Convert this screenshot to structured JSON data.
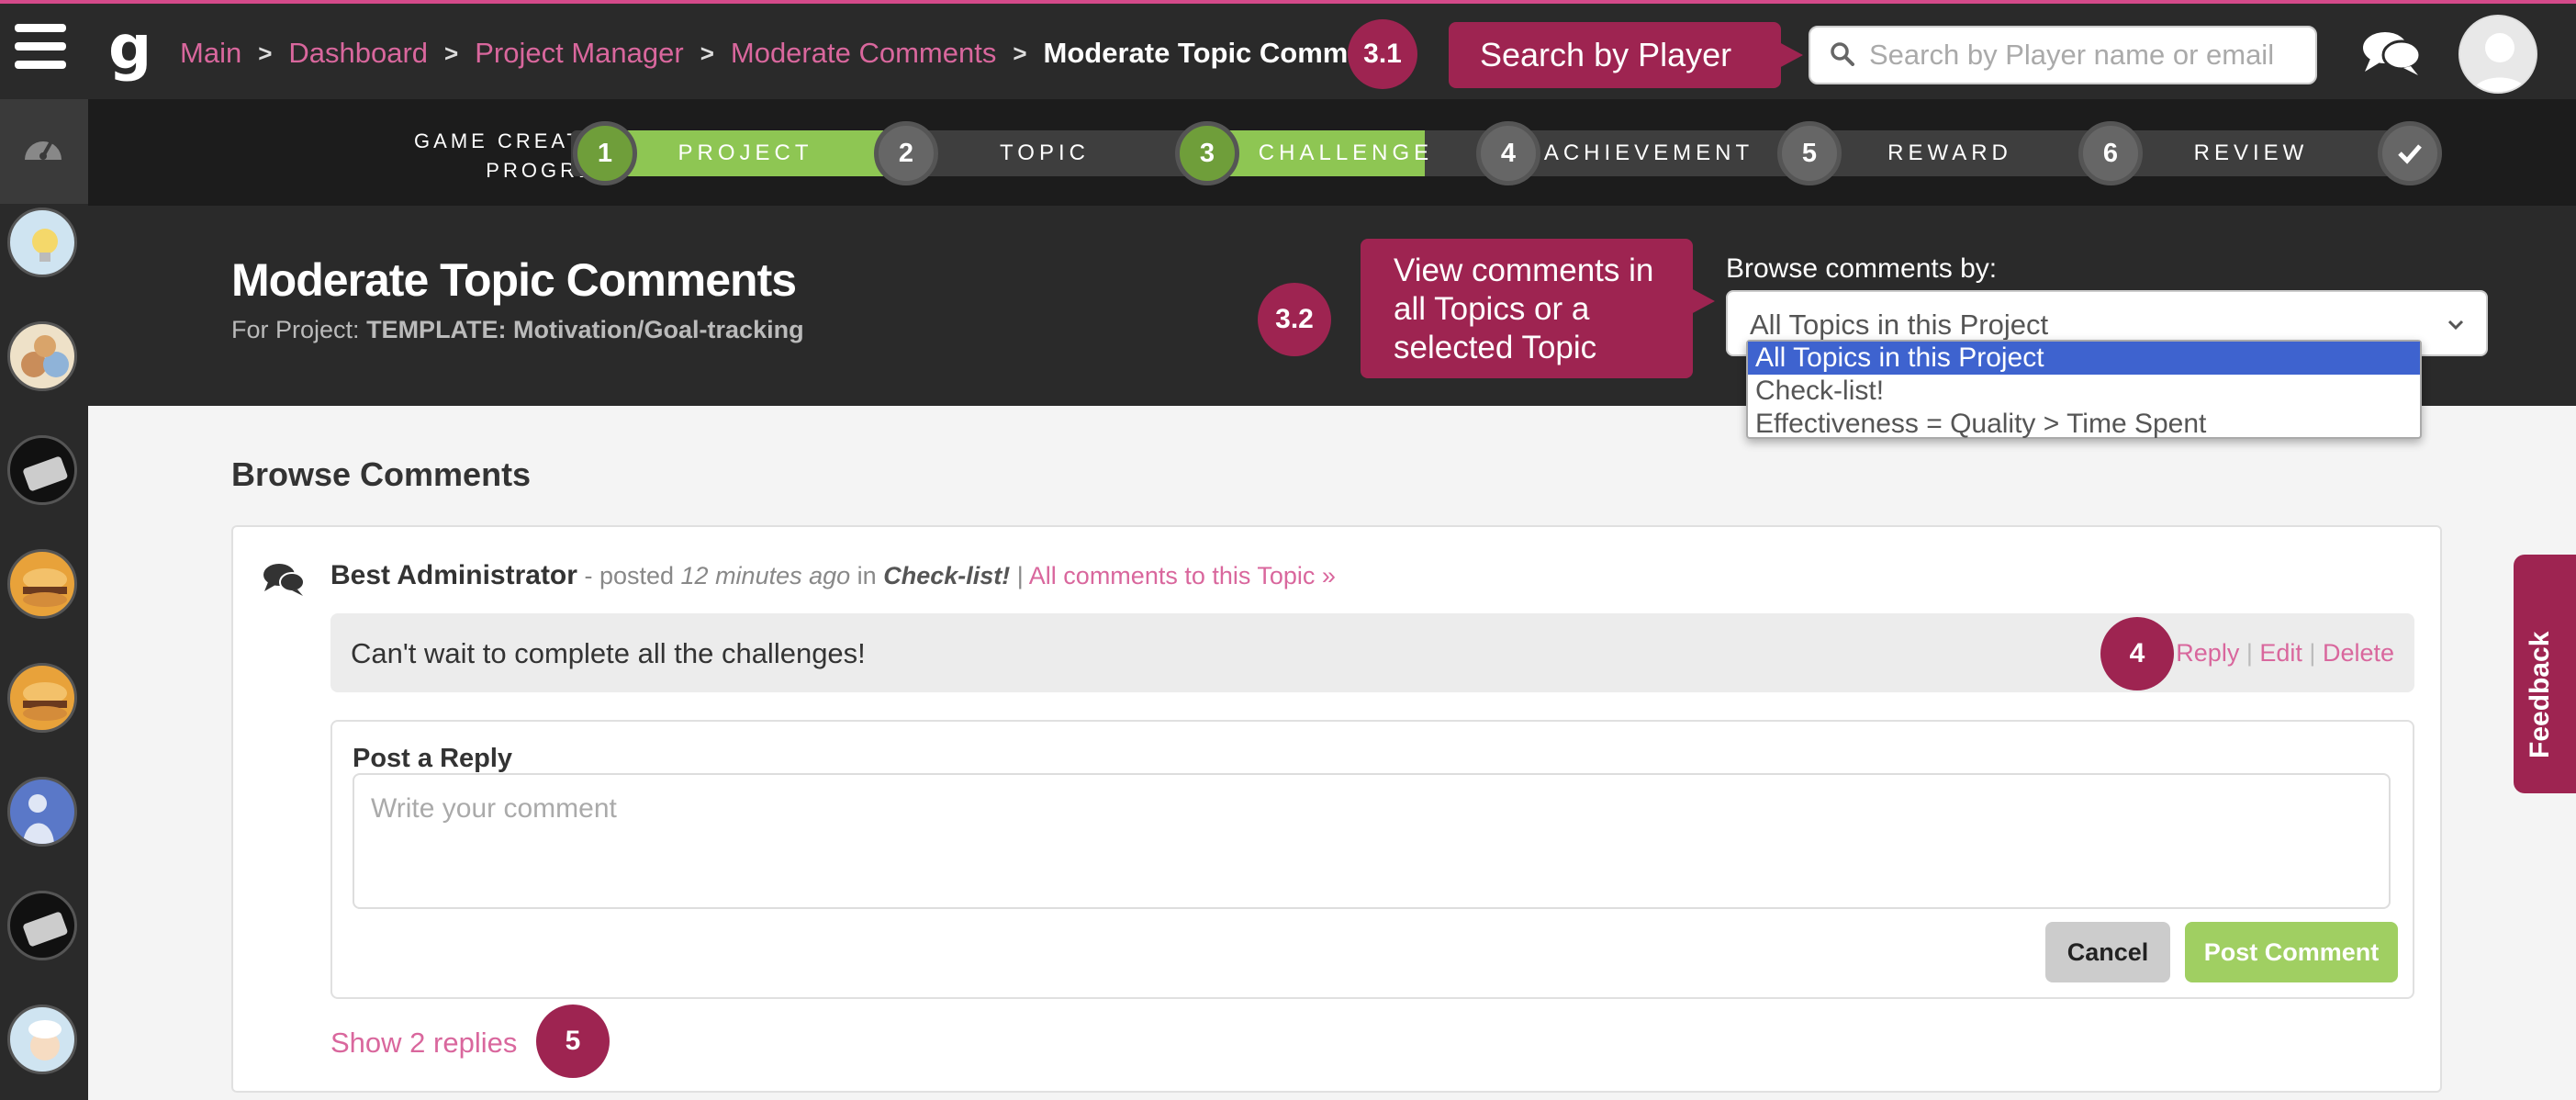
{
  "topbar": {
    "breadcrumb": [
      "Main",
      "Dashboard",
      "Project Manager",
      "Moderate Comments"
    ],
    "breadcrumb_current": "Moderate Topic Comments",
    "search_placeholder": "Search by Player name or email"
  },
  "annotations": {
    "badge_3_1": "3.1",
    "callout_3_1": "Search by Player",
    "badge_3_2": "3.2",
    "callout_3_2": "View comments in all Topics or a selected Topic",
    "badge_4": "4",
    "badge_5": "5"
  },
  "progress": {
    "label_line1": "GAME CREATION",
    "label_line2": "PROGRESS",
    "steps": [
      {
        "number": "1",
        "label": "PROJECT",
        "done": true
      },
      {
        "number": "2",
        "label": "TOPIC",
        "done": false
      },
      {
        "number": "3",
        "label": "CHALLENGE",
        "done": true
      },
      {
        "number": "4",
        "label": "ACHIEVEMENT",
        "done": false
      },
      {
        "number": "5",
        "label": "REWARD",
        "done": false
      },
      {
        "number": "6",
        "label": "REVIEW",
        "done": false
      }
    ],
    "final_step_icon": "checkmark-icon"
  },
  "header": {
    "title": "Moderate Topic Comments",
    "subtitle_prefix": "For Project:",
    "project_name": "TEMPLATE: Motivation/Goal-tracking",
    "browse_label": "Browse comments by:",
    "selected": "All Topics in this Project",
    "options": [
      "All Topics in this Project",
      "Check-list!",
      "Effectiveness = Quality > Time Spent"
    ]
  },
  "content": {
    "heading": "Browse Comments",
    "comment": {
      "author": "Best Administrator",
      "posted": "- posted",
      "time": "12 minutes ago",
      "in": "in",
      "topic": "Check-list!",
      "separator": "|",
      "all_link": "All comments to this Topic »",
      "text": "Can't wait to complete all the challenges!",
      "reply": "Reply",
      "edit": "Edit",
      "delete": "Delete",
      "action_sep": "|"
    },
    "reply_form": {
      "title": "Post a Reply",
      "placeholder": "Write your comment",
      "cancel": "Cancel",
      "post": "Post Comment"
    },
    "show_replies": "Show 2 replies"
  },
  "feedback": "Feedback",
  "colors": {
    "accent": "#9e2451",
    "link": "#d9679d",
    "progress_done": "#8ec653",
    "dropdown_selected": "#3e63cf"
  }
}
